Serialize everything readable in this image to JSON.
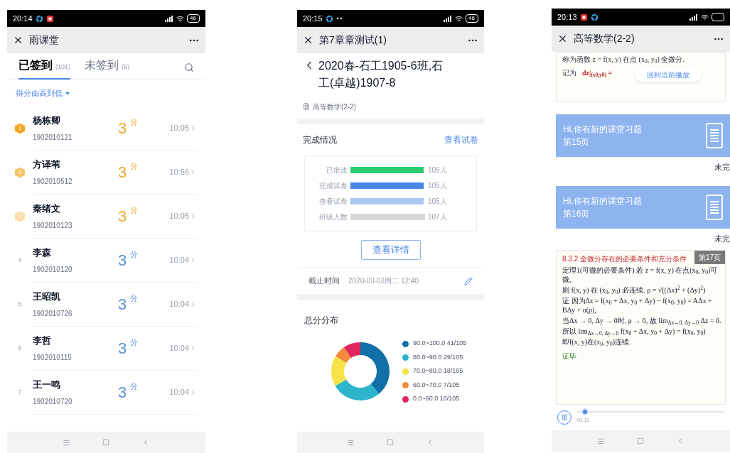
{
  "checkin_screen": {
    "status_bar": {
      "time": "20:14",
      "battery": "46"
    },
    "header": {
      "title": "雨课堂"
    },
    "tabs": [
      {
        "label": "已签到",
        "count": "(101)",
        "selected": true
      },
      {
        "label": "未签到",
        "count": "(6)",
        "selected": false
      }
    ],
    "sort": "得分由高到低",
    "rows": [
      {
        "kind": "medal",
        "rank": "1",
        "color": "#f5a623",
        "name": "杨栋卿",
        "id": "1902010121",
        "score": "3",
        "unit": "分",
        "time": "10:05"
      },
      {
        "kind": "medal",
        "rank": "2",
        "color": "#f7c46a",
        "name": "方译苇",
        "id": "1902010512",
        "score": "3",
        "unit": "分",
        "time": "10:56"
      },
      {
        "kind": "medal",
        "rank": "3",
        "color": "#fbdca8",
        "name": "秦绪文",
        "id": "1902010123",
        "score": "3",
        "unit": "分",
        "time": "10:05"
      },
      {
        "kind": "plain",
        "rank": "4",
        "name": "李森",
        "id": "1902010120",
        "score": "3",
        "unit": "分",
        "time": "10:04"
      },
      {
        "kind": "plain",
        "rank": "5",
        "name": "王昭凯",
        "id": "1902010726",
        "score": "3",
        "unit": "分",
        "time": "10:04"
      },
      {
        "kind": "plain",
        "rank": "6",
        "name": "李哲",
        "id": "1902010115",
        "score": "3",
        "unit": "分",
        "time": "10:04"
      },
      {
        "kind": "plain",
        "rank": "7",
        "name": "王一鸣",
        "id": "1902010720",
        "score": "3",
        "unit": "分",
        "time": "10:04"
      }
    ]
  },
  "test_screen": {
    "status_bar": {
      "time": "20:15",
      "battery": "46"
    },
    "header": {
      "title": "第7章章测试(1)"
    },
    "class_title": "2020春-石工1905-6班,石工(卓越)1907-8",
    "course": "高等数学(2-2)",
    "completion": {
      "title": "完成情况",
      "link": "查看试卷",
      "chart_data": {
        "type": "bar",
        "orientation": "horizontal",
        "categories": [
          "已批改",
          "完成试卷",
          "查看试卷",
          "班级人数"
        ],
        "values": [
          105,
          105,
          105,
          107
        ],
        "value_labels": [
          "105人",
          "105人",
          "105人",
          "107人"
        ],
        "colors": [
          "#2ecc71",
          "#4a86e8",
          "#a9c8f2",
          "#d6d6d6"
        ]
      },
      "button": "查看详情"
    },
    "deadline": {
      "label": "截止时间",
      "value": "2020-03-03周二 12:40"
    },
    "distribution": {
      "title": "总分分布",
      "chart_data": {
        "type": "donut",
        "values": [
          39.05,
          27.62,
          17.14,
          6.67,
          9.52
        ]
      },
      "legend": [
        {
          "label": "90.0~100.0 41/105",
          "color": "#1170a8"
        },
        {
          "label": "80.0~90.0 29/105",
          "color": "#2eb5cc"
        },
        {
          "label": "70.0~80.0 18/105",
          "color": "#f7e24a"
        },
        {
          "label": "60.0~70.0 7/105",
          "color": "#f58a3c"
        },
        {
          "label": "0.0~60.0 10/105",
          "color": "#e0245e"
        }
      ]
    }
  },
  "lecture_screen": {
    "status_bar": {
      "time": "20:13"
    },
    "header": {
      "title": "高等数学(2-2)"
    },
    "prev_slide": {
      "line": "称为函数 z = f(x, y) 在点 (x$_{0}$, y$_{0}$) 全微分.",
      "label": "记为",
      "formula": "dz|$_{(x0,y0)}$ ="
    },
    "resume_button": "回到当前播放",
    "exercises": [
      {
        "greeting": "Hi,你有新的课堂习题",
        "page": "第15页",
        "status": "未完"
      },
      {
        "greeting": "Hi,你有新的课堂习题",
        "page": "第16页",
        "status": "未完"
      }
    ],
    "slide": {
      "heading": "8.3.2 全微分存在的必要条件和充分条件",
      "page": "第17页",
      "lines": [
        "定理1(可微的必要条件) 若 z = f(x, y) 在点(x$_{0}$, y$_{0}$)可微,",
        "则 f(x, y) 在 (x$_{0}$, y$_{0}$) 必连续.   ρ = √((Δx)$^{2}$ + (Δy)$^{2}$)",
        "证 因为Δz = f(x$_{0}$ + Δx, y$_{0}$ + Δy) − f(x$_{0}$, y$_{0}$) = AΔx + BΔy + o(ρ),",
        "当Δx → 0, Δy → 0时, ρ → 0, 故 lim$_{Δx→0, Δy→0}$ Δz = 0.",
        "所以 lim$_{Δx→0, Δy→0}$ f(x$_{0}$ + Δx, y$_{0}$ + Δy) = f(x$_{0}$, y$_{0}$)",
        "即f(x, y)在(x$_{0}$, y$_{0}$)连续."
      ],
      "end_mark": "证毕"
    },
    "player": {
      "playing": true,
      "level": 0.03,
      "elapsed": "01:11"
    }
  }
}
